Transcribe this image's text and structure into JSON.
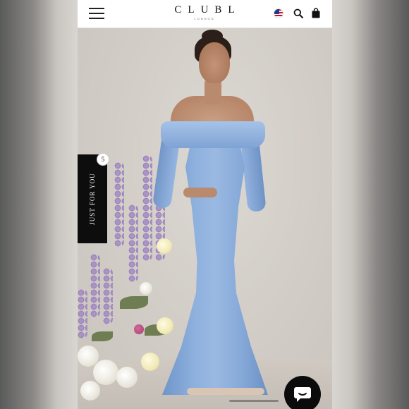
{
  "header": {
    "logo_text": "CLUBL",
    "logo_subtext": "LONDON",
    "icons": [
      "menu-icon",
      "us-flag-icon",
      "search-icon",
      "bag-icon"
    ]
  },
  "side_tab": {
    "label": "JUST FOR YOU",
    "badge_count": "5"
  },
  "hero": {
    "dress_color": "#8fb0dd"
  },
  "chat": {
    "icon": "chat-icon"
  },
  "colors": {
    "header_bg": "#ffffff",
    "tab_bg": "#0d0d0d",
    "chat_bg": "#0b0b0b"
  }
}
